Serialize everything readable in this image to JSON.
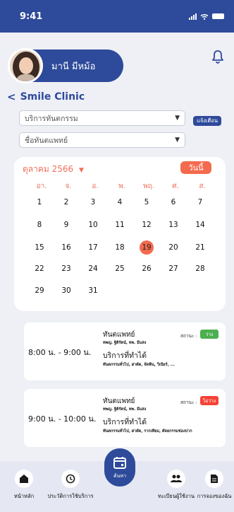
{
  "status": {
    "time": "9:41"
  },
  "profile": {
    "name": "มานี มีหม้อ"
  },
  "clinic": {
    "name": "Smile Clinic"
  },
  "filters": {
    "service": "บริการทันตกรรม",
    "dentist": "ชื่อทันตแพทย์",
    "notify_label": "แจ้งเตือน"
  },
  "calendar": {
    "month_label": "ตุลาคม 2566",
    "today_label": "วันนี้",
    "weekdays": [
      "อา.",
      "จ.",
      "อ.",
      "พ.",
      "พฤ.",
      "ศ.",
      "ส."
    ],
    "weeks": [
      [
        "",
        "1",
        "2",
        "3",
        "4",
        "5",
        "6",
        "7"
      ],
      [
        "8",
        "9",
        "10",
        "11",
        "12",
        "13",
        "14"
      ],
      [
        "15",
        "16",
        "17",
        "18",
        "19",
        "20",
        "21"
      ],
      [
        "22",
        "23",
        "24",
        "25",
        "26",
        "27",
        "28"
      ],
      [
        "29",
        "30",
        "31"
      ]
    ],
    "selected_day": "19"
  },
  "slots": [
    {
      "time": "8:00 น. - 9:00 น.",
      "doctor_heading": "ทันตแพทย์",
      "doctor": "ทพญ. ฐิติรัตน์, ทพ. มีแสง",
      "status_label": "สถานะ :",
      "status": "ว่าง",
      "status_color": "#4caf50",
      "service_heading": "บริการที่ทำได้",
      "services": "ทันตกรรมทั่วไป, ผ่าตัด, จัดฟัน, วีเนียร์, ..."
    },
    {
      "time": "9:00 น. - 10:00 น.",
      "doctor_heading": "ทันตแพทย์",
      "doctor": "ทพญ. ฐิติรัตน์, ทพ. มีแสง",
      "status_label": "สถานะ :",
      "status": "ไม่ว่าง",
      "status_color": "#f44336",
      "service_heading": "บริการที่ทำได้",
      "services": "ทันตกรรมทั่วไป, ผ่าตัด, รากเทียม, ศัลยกรรมช่องปาก"
    }
  ],
  "nav": {
    "home": "หน้าหลัก",
    "history": "ประวัติการใช้บริการ",
    "search": "ค้นหา",
    "register": "ทะเบียนผู้ใช้งาน",
    "booking": "การจองของฉัน"
  },
  "colors": {
    "primary": "#2e4a9a",
    "accent": "#f46a4e"
  }
}
